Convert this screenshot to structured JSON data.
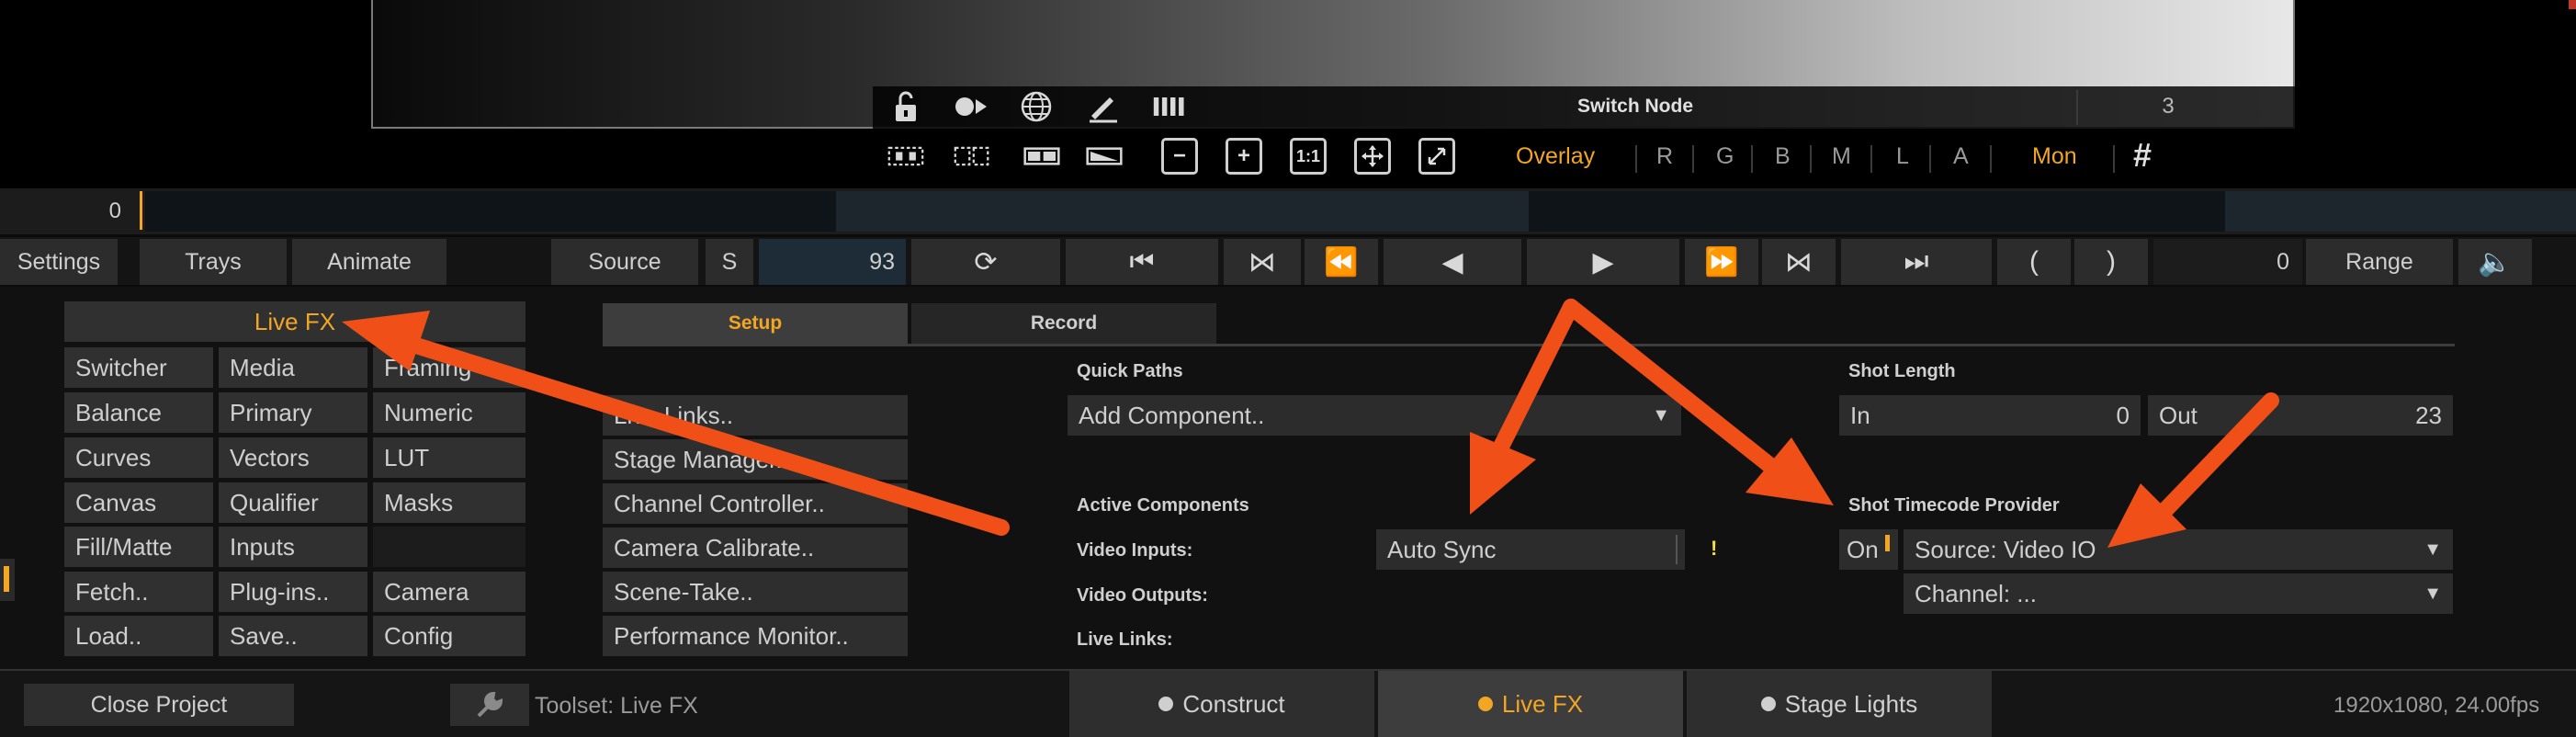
{
  "colors": {
    "accent": "#f2a623",
    "arrow": "#f05018"
  },
  "viewer": {
    "node_name": "Switch Node",
    "node_count": "3",
    "icons": [
      "unlock-icon",
      "record-icon",
      "globe-icon",
      "pencil-icon",
      "bars-icon"
    ],
    "overlay_label": "Overlay",
    "channels": [
      "R",
      "G",
      "B",
      "M",
      "L",
      "A"
    ],
    "mon_label": "Mon",
    "zoom_labels": [
      "1:1"
    ]
  },
  "timeline": {
    "frame": "0"
  },
  "transport": {
    "settings": "Settings",
    "trays": "Trays",
    "animate": "Animate",
    "source": "Source",
    "s": "S",
    "frame": "93",
    "counter": "0",
    "range": "Range"
  },
  "sidebar": {
    "title": "Live FX",
    "grid": [
      [
        "Switcher",
        "Media",
        "Framing"
      ],
      [
        "Balance",
        "Primary",
        "Numeric"
      ],
      [
        "Curves",
        "Vectors",
        "LUT"
      ],
      [
        "Canvas",
        "Qualifier",
        "Masks"
      ],
      [
        "Fill/Matte",
        "Inputs",
        ""
      ],
      [
        "Fetch..",
        "Plug-ins..",
        "Camera"
      ],
      [
        "Load..",
        "Save..",
        "Config"
      ]
    ]
  },
  "tools": {
    "items": [
      "Live Links..",
      "Stage Manager..",
      "Channel Controller..",
      "Camera Calibrate..",
      "Scene-Take..",
      "Performance Monitor.."
    ]
  },
  "tabs": {
    "setup": "Setup",
    "record": "Record"
  },
  "setup": {
    "quick_paths_label": "Quick Paths",
    "add_component": "Add Component..",
    "active_components_label": "Active Components",
    "video_inputs_label": "Video Inputs:",
    "video_outputs_label": "Video Outputs:",
    "live_links_label": "Live Links:",
    "auto_sync": "Auto Sync",
    "warning": "!",
    "shot_length_label": "Shot Length",
    "in_label": "In",
    "in_value": "0",
    "out_label": "Out",
    "out_value": "23",
    "timecode_label": "Shot Timecode Provider",
    "on_label": "On",
    "source": "Source: Video IO",
    "channel": "Channel: ..."
  },
  "footer": {
    "close_project": "Close Project",
    "toolset": "Toolset: Live FX",
    "tabs": [
      {
        "label": "Construct",
        "dot": "#cfcfcf"
      },
      {
        "label": "Live FX",
        "dot": "#f2a623"
      },
      {
        "label": "Stage Lights",
        "dot": "#cfcfcf"
      }
    ],
    "resolution": "1920x1080, 24.00fps"
  }
}
